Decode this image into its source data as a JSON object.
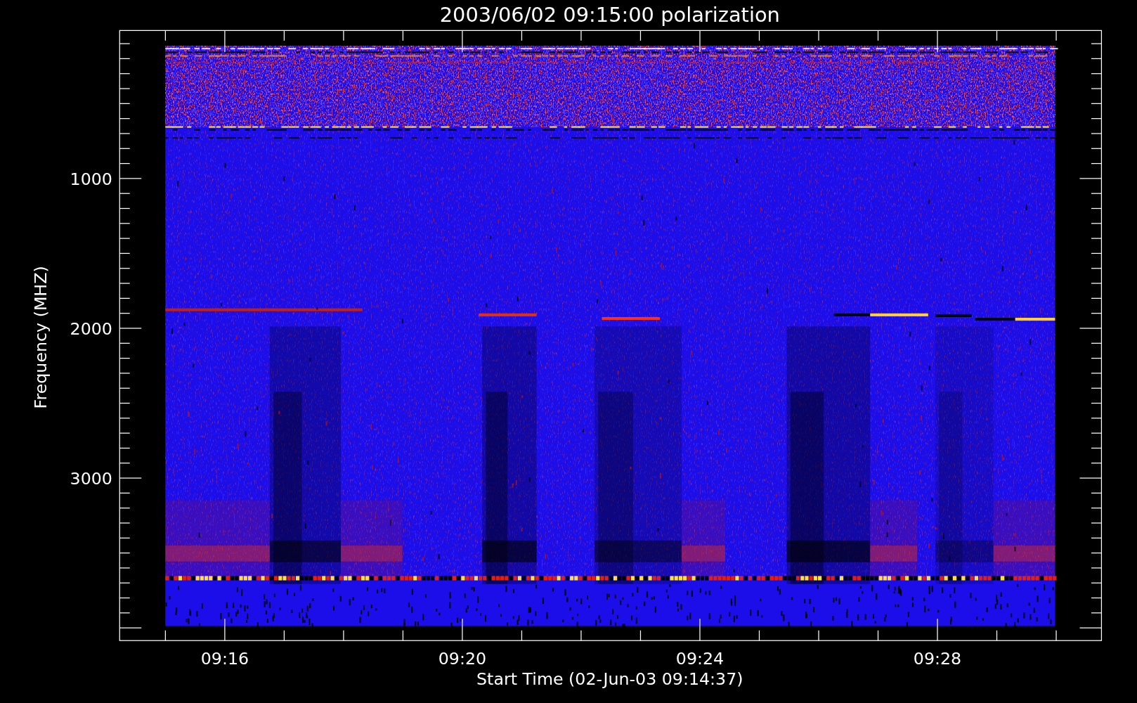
{
  "title": "2003/06/02 09:15:00 polarization",
  "plot": {
    "ylabel": "Frequency (MHZ)",
    "xlabel": "Start Time (02-Jun-03 09:14:37)",
    "yticks": [
      "1000",
      "2000",
      "3000"
    ],
    "xticks": [
      "09:16",
      "09:20",
      "09:24",
      "09:28"
    ]
  }
}
